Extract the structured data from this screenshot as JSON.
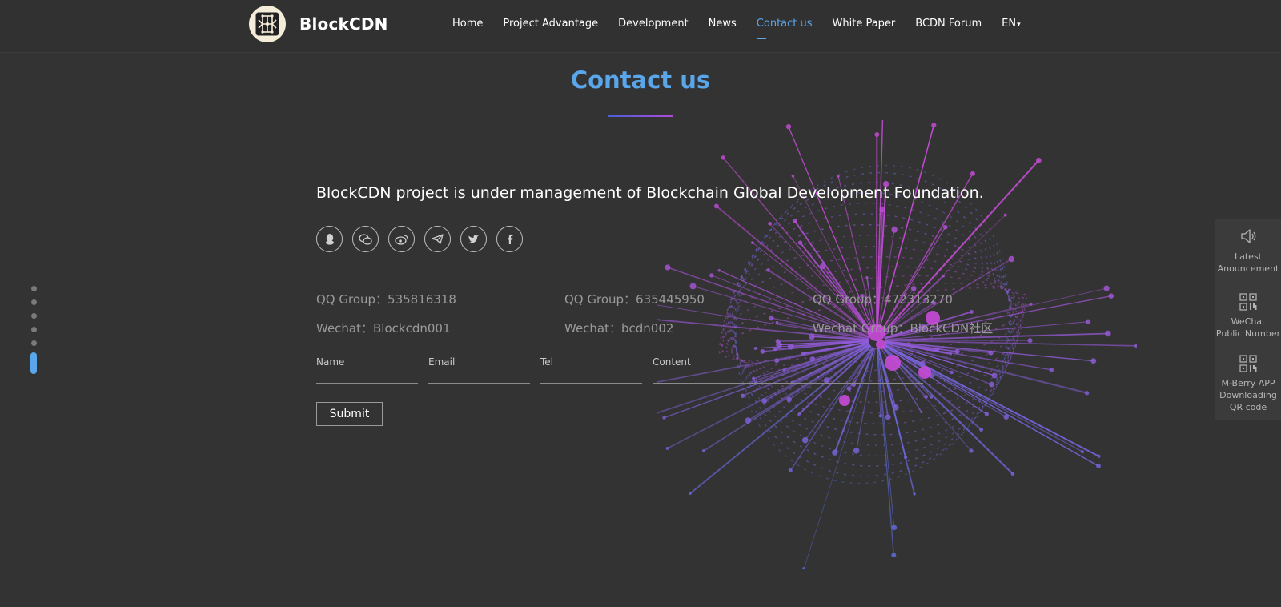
{
  "header": {
    "brand": "BlockCDN",
    "nav": [
      {
        "label": "Home",
        "active": false
      },
      {
        "label": "Project Advantage",
        "active": false
      },
      {
        "label": "Development",
        "active": false
      },
      {
        "label": "News",
        "active": false
      },
      {
        "label": "Contact us",
        "active": true
      },
      {
        "label": "White Paper",
        "active": false
      },
      {
        "label": "BCDN Forum",
        "active": false
      },
      {
        "label": "EN",
        "active": false
      }
    ],
    "language_caret": "▾"
  },
  "section": {
    "title": "Contact us",
    "intro": "BlockCDN project is under management of Blockchain Global Development Foundation."
  },
  "socials": [
    {
      "icon": "qq-icon",
      "glyph": "♟"
    },
    {
      "icon": "wechat-icon",
      "glyph": "☺"
    },
    {
      "icon": "weibo-icon",
      "glyph": "◎"
    },
    {
      "icon": "telegram-icon",
      "glyph": "➤"
    },
    {
      "icon": "twitter-icon",
      "glyph": "✦"
    },
    {
      "icon": "facebook-icon",
      "glyph": "f"
    }
  ],
  "contacts": {
    "row1": [
      "QQ Group：535816318",
      "QQ Group：635445950",
      "QQ Group：472313270"
    ],
    "row2": [
      "Wechat：Blockcdn001",
      "Wechat：bcdn002",
      "Wechat Group：BlockCDN社区"
    ]
  },
  "form": {
    "name_placeholder": "Name",
    "email_placeholder": "Email",
    "tel_placeholder": "Tel",
    "content_placeholder": "Content",
    "submit_label": "Submit"
  },
  "pager": {
    "count": 6,
    "active_index": 5
  },
  "side_panel": {
    "announcement": {
      "line1": "Latest",
      "line2": "Anouncement"
    },
    "wechat": {
      "line1": "WeChat",
      "line2": "Public Number"
    },
    "app": {
      "line1": "M-Berry APP",
      "line2": "Downloading",
      "line3": "QR code"
    }
  },
  "colors": {
    "background": "#333333",
    "accent": "#5aa6ea",
    "sphere_primary": "#c84bd8",
    "sphere_secondary": "#5a6ee0"
  }
}
